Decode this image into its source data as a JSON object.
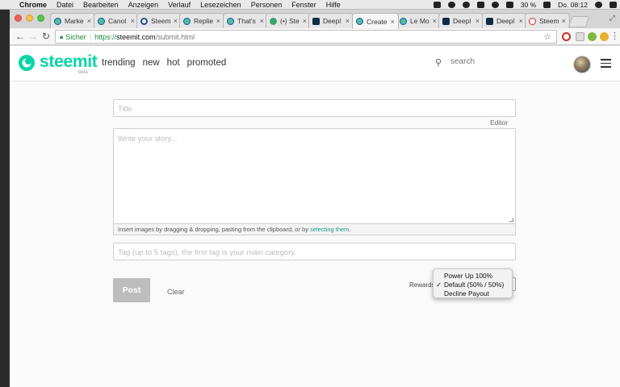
{
  "menubar": {
    "app": "Chrome",
    "items": [
      "Datei",
      "Bearbeiten",
      "Anzeigen",
      "Verlauf",
      "Lesezeichen",
      "Personen",
      "Fenster",
      "Hilfe"
    ],
    "battery": "30 %",
    "clock": "Do. 08:12"
  },
  "tabs": [
    {
      "title": "Marke",
      "icon": "steemit-favicon"
    },
    {
      "title": "Canol",
      "icon": "steemit-favicon"
    },
    {
      "title": "Steem",
      "icon": "steem-favicon"
    },
    {
      "title": "Replie",
      "icon": "steemit-favicon"
    },
    {
      "title": "That's",
      "icon": "steemit-favicon"
    },
    {
      "title": "(•) Ste",
      "icon": "chat-favicon"
    },
    {
      "title": "Deepl",
      "icon": "deepl-favicon"
    },
    {
      "title": "Create",
      "icon": "steemit-favicon",
      "active": true
    },
    {
      "title": "Le Mo",
      "icon": "steemit-favicon"
    },
    {
      "title": "Deepl",
      "icon": "deepl-favicon"
    },
    {
      "title": "Deepl",
      "icon": "deepl-favicon"
    },
    {
      "title": "Steem",
      "icon": "red-favicon"
    }
  ],
  "tab_close": "×",
  "omnibox": {
    "secure_label": "Sicher",
    "url_scheme": "https://",
    "url_host": "steemit.com",
    "url_path": "/submit.html"
  },
  "site": {
    "logo_text": "steemit",
    "logo_beta": "beta",
    "nav": [
      "trending",
      "new",
      "hot",
      "promoted"
    ],
    "search_placeholder": "search"
  },
  "form": {
    "title_placeholder": "Title",
    "editor_link": "Editor",
    "story_placeholder": "Write your story...",
    "hint_text": "Insert images by dragging & dropping, pasting from the clipboard, or by ",
    "hint_link": "selecting them",
    "hint_end": ".",
    "tags_placeholder": "Tag (up to 5 tags), the first tag is your main category.",
    "post_label": "Post",
    "clear_label": "Clear",
    "rewards_label": "Rewards"
  },
  "rewards_menu": {
    "options": [
      {
        "label": "Power Up 100%",
        "checked": false
      },
      {
        "label": "Default (50% / 50%)",
        "checked": true
      },
      {
        "label": "Decline Payout",
        "checked": false
      }
    ],
    "check_glyph": "✓"
  },
  "colors": {
    "brand": "#06d6a9",
    "secure": "#1d8a3b",
    "link": "#1a9a82"
  }
}
